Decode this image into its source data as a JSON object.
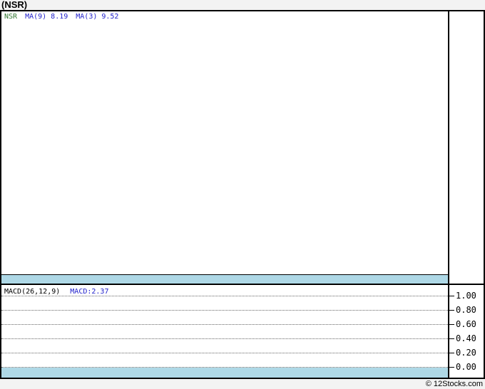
{
  "window": {
    "title": "(NSR)",
    "credit": "© 12Stocks.com"
  },
  "main_panel": {
    "legend": {
      "symbol": "NSR",
      "items": [
        {
          "label": "MA(9)",
          "value": "8.19"
        },
        {
          "label": "MA(3)",
          "value": "9.52"
        }
      ]
    }
  },
  "macd_panel": {
    "indicator_label": "MACD(26,12,9)",
    "indicator_value": "MACD:2.37",
    "y_axis": {
      "ticks": [
        "1.00",
        "0.80",
        "0.60",
        "0.40",
        "0.20",
        "0.00"
      ]
    }
  },
  "colors": {
    "background": "#f3f3f3",
    "panel_background": "#ffffff",
    "border": "#000000",
    "band_blue": "#aed8e6",
    "symbol_green": "#337733",
    "value_blue": "#2222cc",
    "gridline": "#666666"
  },
  "chart_data": [
    {
      "type": "line",
      "title": "(NSR)",
      "series": [
        {
          "name": "NSR",
          "color": "#337733",
          "values": []
        },
        {
          "name": "MA(9)",
          "color": "#2222cc",
          "last_value": 8.19,
          "values": []
        },
        {
          "name": "MA(3)",
          "color": "#2222cc",
          "last_value": 9.52,
          "values": []
        }
      ],
      "legend_position": "top-left",
      "grid": false,
      "note": "price panel renders empty; only a light-blue band along the bottom"
    },
    {
      "type": "line",
      "title": "MACD(26,12,9)",
      "series": [
        {
          "name": "MACD",
          "last_value": 2.37,
          "values": []
        }
      ],
      "ylim": [
        0.0,
        1.0
      ],
      "yticks": [
        1.0,
        0.8,
        0.6,
        0.4,
        0.2,
        0.0
      ],
      "grid": true,
      "legend_position": "top-left",
      "note": "MACD panel renders empty; dotted horizontal gridlines and a light-blue band along the bottom"
    }
  ]
}
